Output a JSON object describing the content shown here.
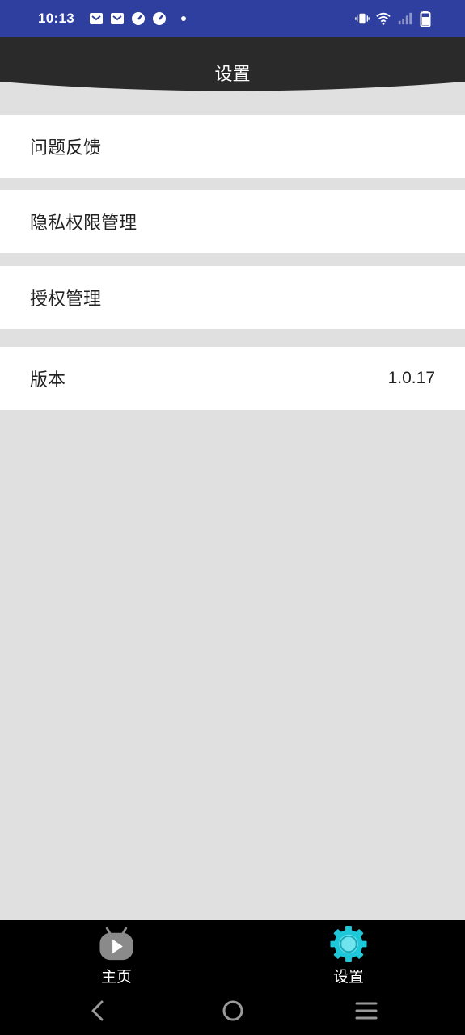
{
  "status_bar": {
    "time": "10:13",
    "left_icons": [
      "mail-icon",
      "mail-icon",
      "speed-icon",
      "speed-icon",
      "dot-icon"
    ],
    "right_icons": [
      "vibrate-icon",
      "wifi-icon",
      "signal-icon",
      "battery-icon"
    ]
  },
  "header": {
    "title": "设置",
    "background": "#2a2a2a"
  },
  "settings": {
    "items": [
      {
        "label": "问题反馈",
        "value": ""
      },
      {
        "label": "隐私权限管理",
        "value": ""
      },
      {
        "label": "授权管理",
        "value": ""
      },
      {
        "label": "版本",
        "value": "1.0.17"
      }
    ]
  },
  "bottom_nav": {
    "items": [
      {
        "label": "主页",
        "icon": "home-play-icon",
        "active": false
      },
      {
        "label": "设置",
        "icon": "settings-gear-icon",
        "active": true
      }
    ],
    "active_color": "#1ec8d8"
  },
  "system_nav": {
    "buttons": [
      "back-icon",
      "home-circle-icon",
      "menu-icon"
    ]
  }
}
